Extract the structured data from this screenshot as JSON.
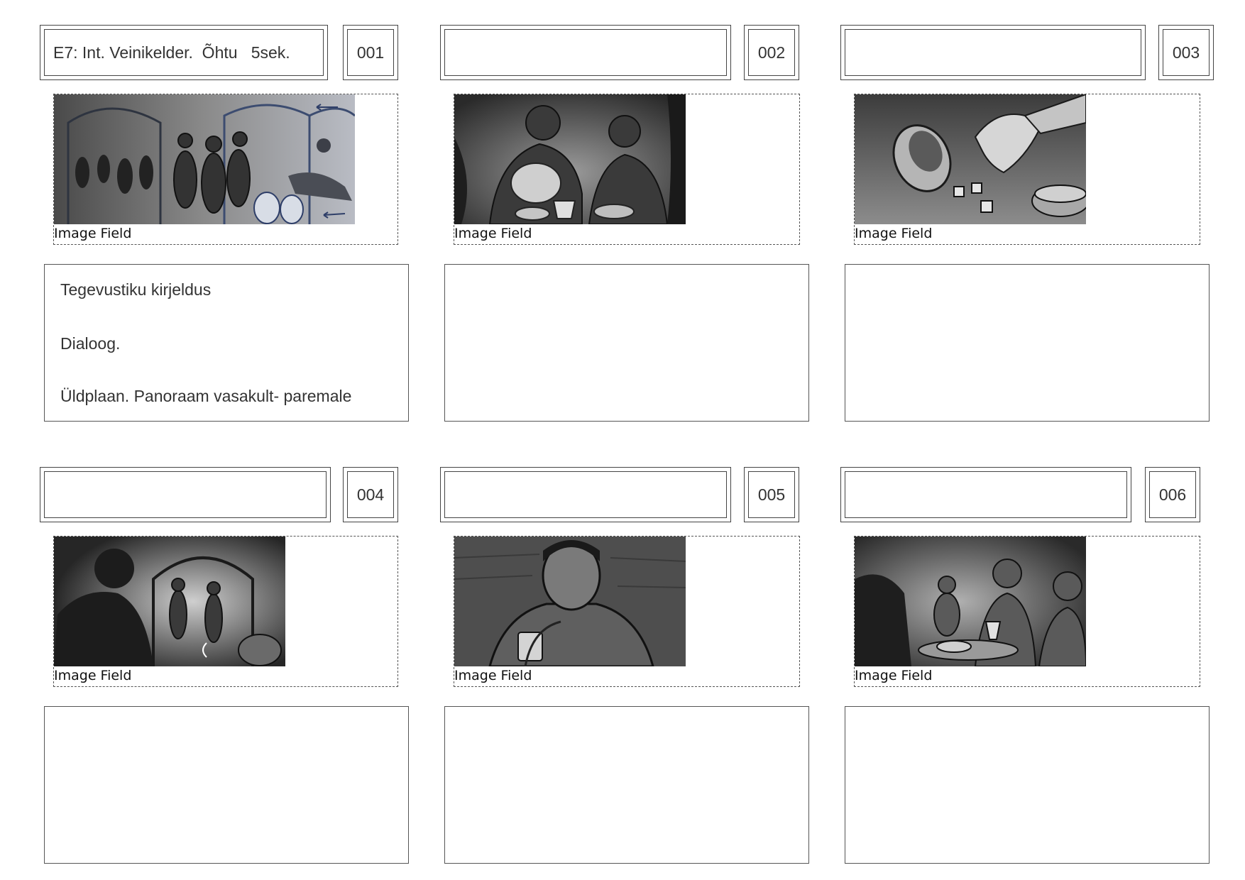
{
  "image_field_label": "Image Field",
  "panels": [
    {
      "number": "001",
      "title": "E7: Int. Veinikelder.  Õhtu   5sek.",
      "sketch": "sketch-crowd-running-through-cellar",
      "description": [
        "Tegevustiku kirjeldus",
        "Dialoog.",
        "Üldplaan. Panoraam vasakult- paremale"
      ]
    },
    {
      "number": "002",
      "title": "",
      "sketch": "sketch-two-men-pouring-wine",
      "description": []
    },
    {
      "number": "003",
      "title": "",
      "sketch": "sketch-hand-throwing-dice",
      "description": []
    },
    {
      "number": "004",
      "title": "",
      "sketch": "sketch-man-watching-fight",
      "description": []
    },
    {
      "number": "005",
      "title": "",
      "sketch": "sketch-man-with-cup-closeup",
      "description": []
    },
    {
      "number": "006",
      "title": "",
      "sketch": "sketch-men-laughing-at-table",
      "description": []
    }
  ]
}
